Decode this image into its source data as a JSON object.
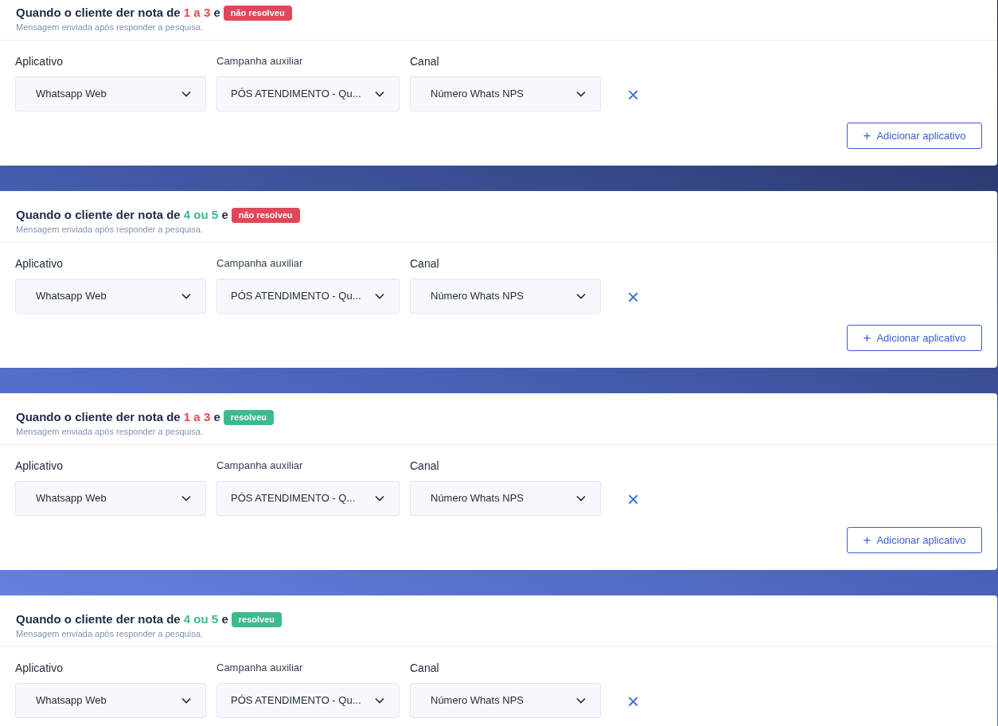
{
  "cards": [
    {
      "title": "Quando o cliente der nota de",
      "range": {
        "text": "1 a 3",
        "color": "#e0475a"
      },
      "connector": "e",
      "badge": {
        "text": "não resolveu",
        "color": "#e0475a"
      },
      "subtitle": "Mensagem enviada após responder a pesquisa.",
      "fields": [
        {
          "label": "Aplicativo",
          "value": "Whatsapp Web"
        },
        {
          "label": "Campanha auxiliar",
          "value": "PÓS ATENDIMENTO - Qu..."
        },
        {
          "label": "Canal",
          "value": "Número Whats NPS"
        }
      ],
      "remove": "×",
      "add_button": {
        "icon": "+",
        "label": "Adicionar aplicativo"
      }
    },
    {
      "title": "Quando o cliente der nota de",
      "range": {
        "text": "4 ou 5",
        "color": "#3dba8c"
      },
      "connector": "e",
      "badge": {
        "text": "não resolveu",
        "color": "#e0475a"
      },
      "subtitle": "Mensagem enviada após responder a pesquisa.",
      "fields": [
        {
          "label": "Aplicativo",
          "value": "Whatsapp Web"
        },
        {
          "label": "Campanha auxiliar",
          "value": "PÓS ATENDIMENTO - Qu..."
        },
        {
          "label": "Canal",
          "value": "Número Whats NPS"
        }
      ],
      "remove": "×",
      "add_button": {
        "icon": "+",
        "label": "Adicionar aplicativo"
      }
    },
    {
      "title": "Quando o cliente der nota de",
      "range": {
        "text": "1 a 3",
        "color": "#e0475a"
      },
      "connector": "e",
      "badge": {
        "text": "resolveu",
        "color": "#3dba8c"
      },
      "subtitle": "Mensagem enviada após responder a pesquisa.",
      "fields": [
        {
          "label": "Aplicativo",
          "value": "Whatsapp Web"
        },
        {
          "label": "Campanha auxiliar",
          "value": "PÓS ATENDIMENTO - Q..."
        },
        {
          "label": "Canal",
          "value": "Número Whats NPS"
        }
      ],
      "remove": "×",
      "add_button": {
        "icon": "+",
        "label": "Adicionar aplicativo"
      }
    },
    {
      "title": "Quando o cliente der nota de",
      "range": {
        "text": "4 ou 5",
        "color": "#3dba8c"
      },
      "connector": "e",
      "badge": {
        "text": "resolveu",
        "color": "#3dba8c"
      },
      "subtitle": "Mensagem enviada após responder a pesquisa.",
      "fields": [
        {
          "label": "Aplicativo",
          "value": "Whatsapp Web"
        },
        {
          "label": "Campanha auxiliar",
          "value": "PÓS ATENDIMENTO - Qu..."
        },
        {
          "label": "Canal",
          "value": "Número Whats NPS"
        }
      ],
      "remove": "×"
    }
  ]
}
